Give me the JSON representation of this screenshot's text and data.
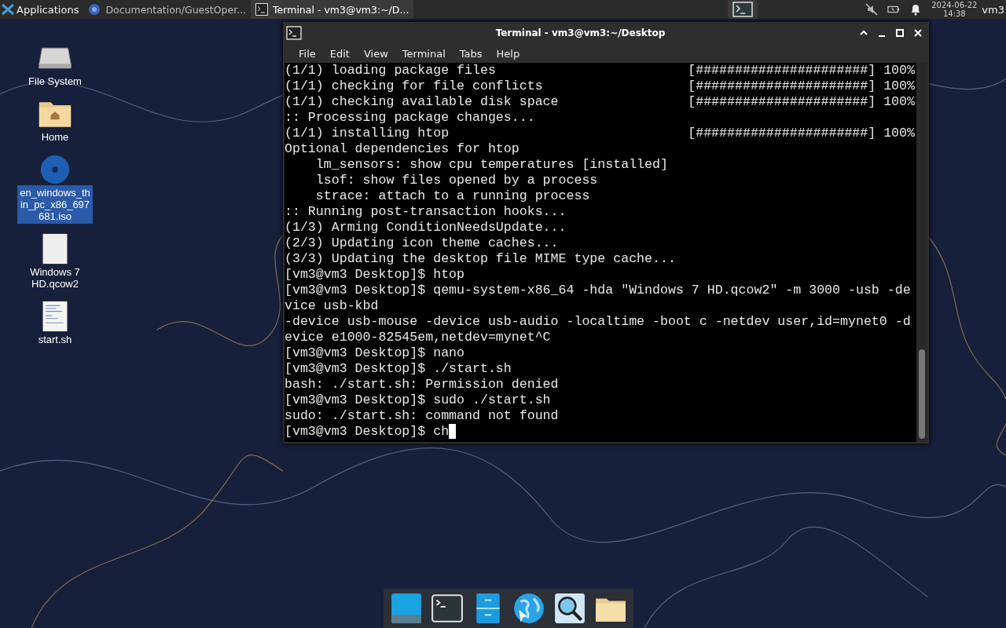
{
  "panel": {
    "menu_label": "Applications",
    "tasks": [
      {
        "kind": "browser",
        "label": "Documentation/GuestOper...",
        "selected": false
      },
      {
        "kind": "terminal",
        "label": "Terminal - vm3@vm3:~/D...",
        "selected": true
      }
    ],
    "date": "2024-06-22",
    "time": "14:38",
    "user": "vm3"
  },
  "desktop_icons": [
    {
      "kind": "drive",
      "label": "File System",
      "selected": false
    },
    {
      "kind": "home",
      "label": "Home",
      "selected": false
    },
    {
      "kind": "disc",
      "label": "en_windows_thin_pc_x86_697681.iso",
      "selected": true
    },
    {
      "kind": "blank",
      "label": "Windows 7 HD.qcow2",
      "selected": false
    },
    {
      "kind": "script",
      "label": "start.sh",
      "selected": false
    }
  ],
  "terminal": {
    "title": "Terminal - vm3@vm3:~/Desktop",
    "menu": [
      "File",
      "Edit",
      "View",
      "Terminal",
      "Tabs",
      "Help"
    ],
    "lines": [
      {
        "text": "(1/1) loading package files",
        "progress": "[######################] 100%"
      },
      {
        "text": "(1/1) checking for file conflicts",
        "progress": "[######################] 100%"
      },
      {
        "text": "(1/1) checking available disk space",
        "progress": "[######################] 100%"
      },
      {
        "text": ":: Processing package changes..."
      },
      {
        "text": "(1/1) installing htop",
        "progress": "[######################] 100%"
      },
      {
        "text": "Optional dependencies for htop"
      },
      {
        "text": "    lm_sensors: show cpu temperatures [installed]"
      },
      {
        "text": "    lsof: show files opened by a process"
      },
      {
        "text": "    strace: attach to a running process"
      },
      {
        "text": ":: Running post-transaction hooks..."
      },
      {
        "text": "(1/3) Arming ConditionNeedsUpdate..."
      },
      {
        "text": "(2/3) Updating icon theme caches..."
      },
      {
        "text": "(3/3) Updating the desktop file MIME type cache..."
      },
      {
        "text": "[vm3@vm3 Desktop]$ htop"
      },
      {
        "text": "[vm3@vm3 Desktop]$ qemu-system-x86_64 -hda \"Windows 7 HD.qcow2\" -m 3000 -usb -de"
      },
      {
        "text": "vice usb-kbd"
      },
      {
        "text": "-device usb-mouse -device usb-audio -localtime -boot c -netdev user,id=mynet0 -d"
      },
      {
        "text": "evice e1000-82545em,netdev=mynet^C"
      },
      {
        "text": "[vm3@vm3 Desktop]$ nano"
      },
      {
        "text": "[vm3@vm3 Desktop]$ ./start.sh"
      },
      {
        "text": "bash: ./start.sh: Permission denied"
      },
      {
        "text": "[vm3@vm3 Desktop]$ sudo ./start.sh"
      },
      {
        "text": "sudo: ./start.sh: command not found"
      }
    ],
    "prompt": "[vm3@vm3 Desktop]$ ch"
  },
  "dock": [
    {
      "kind": "desktop"
    },
    {
      "kind": "terminal"
    },
    {
      "kind": "files-cabinet"
    },
    {
      "kind": "globe"
    },
    {
      "kind": "search"
    },
    {
      "kind": "folder"
    }
  ]
}
